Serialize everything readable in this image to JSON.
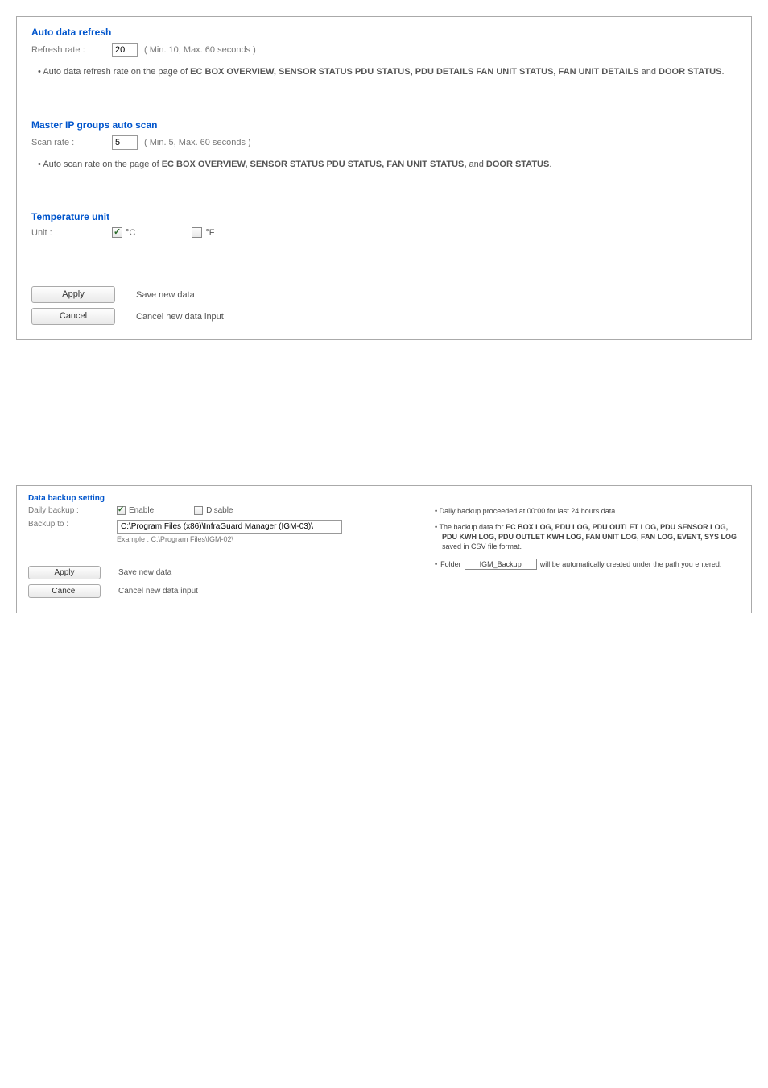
{
  "panel1": {
    "autoRefresh": {
      "title": "Auto data refresh",
      "label": "Refresh rate :",
      "value": "20",
      "hint": "( Min. 10, Max. 60 seconds )",
      "note_pre": "Auto data refresh rate on the page of ",
      "note_bold": "EC BOX OVERVIEW,  SENSOR STATUS  PDU STATUS,  PDU DETAILS  FAN UNIT STATUS,  FAN UNIT DETAILS",
      "note_mid": " and ",
      "note_bold2": "DOOR STATUS",
      "note_end": "."
    },
    "autoScan": {
      "title": "Master IP groups auto scan",
      "label": "Scan rate :",
      "value": "5",
      "hint": "( Min. 5, Max. 60 seconds )",
      "note_pre": "Auto scan rate on the page of ",
      "note_bold": "EC BOX OVERVIEW,  SENSOR STATUS  PDU STATUS,  FAN UNIT STATUS,",
      "note_mid": " and ",
      "note_bold2": "DOOR STATUS",
      "note_end": "."
    },
    "tempUnit": {
      "title": "Temperature unit",
      "label": "Unit :",
      "c_label": "°C",
      "c_checked": true,
      "f_label": "°F",
      "f_checked": false
    },
    "apply": "Apply",
    "applyDesc": "Save new data",
    "cancel": "Cancel",
    "cancelDesc": "Cancel new data input"
  },
  "panel2": {
    "title": "Data backup setting",
    "dailyLabel": "Daily backup :",
    "enableLabel": "Enable",
    "enableChecked": true,
    "disableLabel": "Disable",
    "disableChecked": false,
    "backupLabel": "Backup to :",
    "backupPath": "C:\\Program Files (x86)\\InfraGuard Manager (IGM-03)\\",
    "example": "Example : C:\\Program Files\\IGM-02\\",
    "bullet1": "Daily backup proceeded at 00:00 for last 24 hours data.",
    "bullet2_pre": "The backup data for ",
    "bullet2_bold": "EC BOX LOG,  PDU LOG,  PDU OUTLET LOG,  PDU SENSOR LOG,  PDU KWH LOG,  PDU OUTLET KWH LOG,  FAN UNIT LOG,  FAN LOG,  EVENT,  SYS LOG",
    "bullet2_post": " saved in CSV file format.",
    "folderPre": "Folder",
    "folderName": "IGM_Backup",
    "folderPost": "will be automatically created under the path you entered.",
    "apply": "Apply",
    "applyDesc": "Save new data",
    "cancel": "Cancel",
    "cancelDesc": "Cancel new data input"
  }
}
